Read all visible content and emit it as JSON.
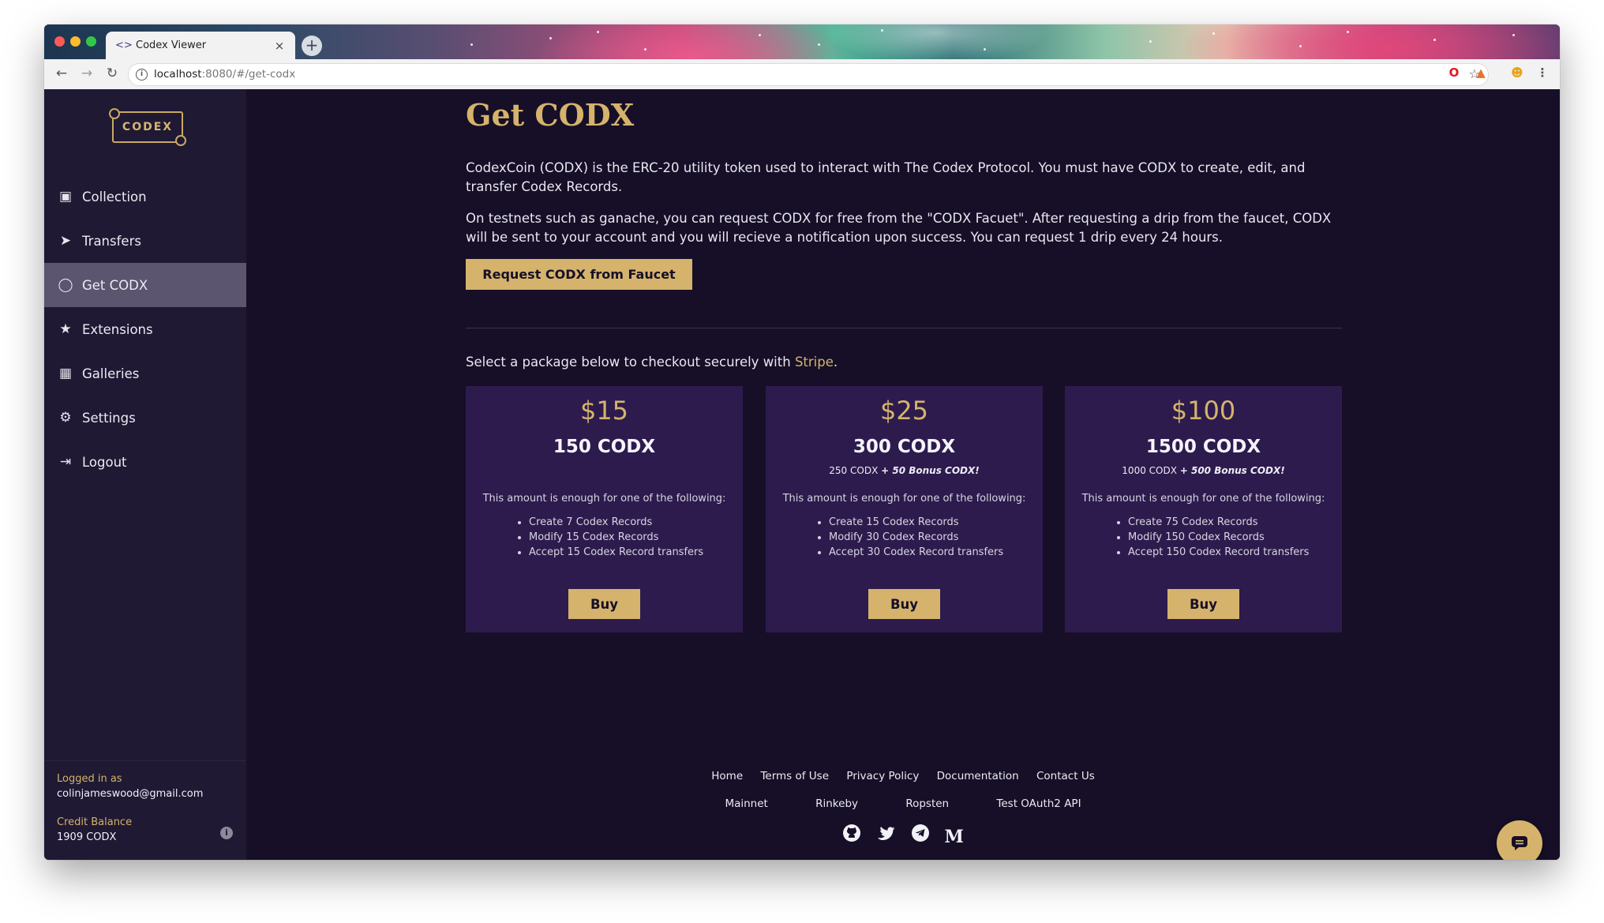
{
  "browser": {
    "tab_title": "Codex Viewer",
    "tab_close": "×",
    "new_tab": "+",
    "url_host": "localhost",
    "url_rest": ":8080/#/get-codx"
  },
  "sidebar": {
    "logo_text": "CODEX",
    "items": [
      {
        "label": "Collection",
        "icon": "collection-icon"
      },
      {
        "label": "Transfers",
        "icon": "paper-plane-icon"
      },
      {
        "label": "Get CODX",
        "icon": "coin-icon",
        "active": true
      },
      {
        "label": "Extensions",
        "icon": "star-icon"
      },
      {
        "label": "Galleries",
        "icon": "gallery-icon"
      },
      {
        "label": "Settings",
        "icon": "gear-icon"
      },
      {
        "label": "Logout",
        "icon": "logout-icon"
      }
    ],
    "logged_in_label": "Logged in as",
    "email": "colinjameswood@gmail.com",
    "credit_label": "Credit Balance",
    "credit_value": "1909 CODX"
  },
  "main": {
    "title": "Get CODX",
    "intro": "CodexCoin (CODX) is the ERC-20 utility token used to interact with The Codex Protocol. You must have CODX to create, edit, and transfer Codex Records.",
    "faucet_text": "On testnets such as ganache, you can request CODX for free from the \"CODX Facuet\". After requesting a drip from the faucet, CODX will be sent to your account and you will recieve a notification upon success. You can request 1 drip every 24 hours.",
    "faucet_button": "Request CODX from Faucet",
    "stripe_prefix": "Select a package below to checkout securely with ",
    "stripe_link": "Stripe",
    "stripe_suffix": ".",
    "enough_text": "This amount is enough for one of the following:",
    "buy_label": "Buy",
    "packages": [
      {
        "price": "$15",
        "amount": "150 CODX",
        "bonus_base": "",
        "bonus_extra": "",
        "items": [
          "Create 7 Codex Records",
          "Modify 15 Codex Records",
          "Accept 15 Codex Record transfers"
        ]
      },
      {
        "price": "$25",
        "amount": "300 CODX",
        "bonus_base": "250 CODX ",
        "bonus_extra": "+ 50 Bonus CODX!",
        "items": [
          "Create 15 Codex Records",
          "Modify 30 Codex Records",
          "Accept 30 Codex Record transfers"
        ]
      },
      {
        "price": "$100",
        "amount": "1500 CODX",
        "bonus_base": "1000 CODX ",
        "bonus_extra": "+ 500 Bonus CODX!",
        "items": [
          "Create 75 Codex Records",
          "Modify 150 Codex Records",
          "Accept 150 Codex Record transfers"
        ]
      }
    ]
  },
  "footer": {
    "links": [
      "Home",
      "Terms of Use",
      "Privacy Policy",
      "Documentation",
      "Contact Us"
    ],
    "networks": [
      "Mainnet",
      "Rinkeby",
      "Ropsten",
      "Test OAuth2 API"
    ],
    "medium": "M"
  }
}
